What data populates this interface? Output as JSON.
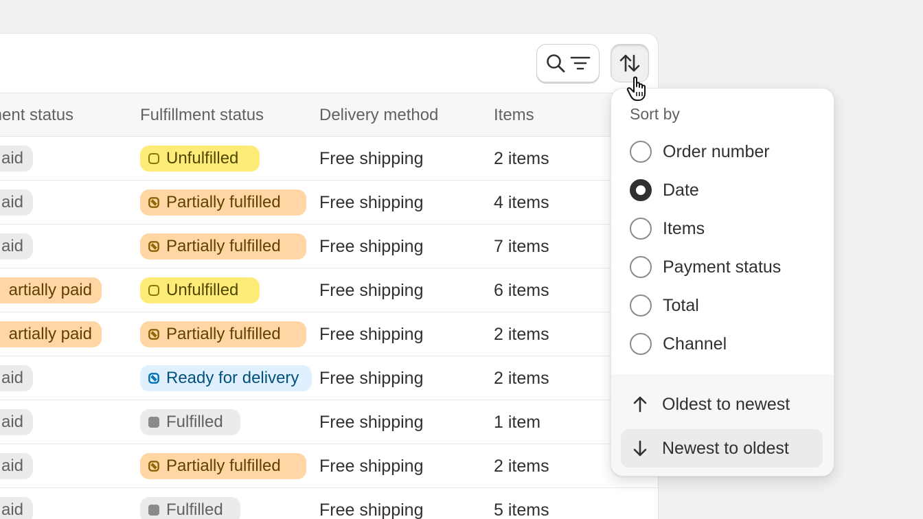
{
  "toolbar": {
    "search_filter_icon": "search-filter-icon",
    "sort_icon": "sort-arrows-icon"
  },
  "table": {
    "headers": [
      "ment status",
      "Fulfillment status",
      "Delivery method",
      "Items"
    ],
    "rows": [
      {
        "payment": "aid",
        "payment_style": "gray",
        "fulfillment": "Unfulfilled",
        "fulfillment_style": "yellow",
        "delivery": "Free shipping",
        "items": "2 items"
      },
      {
        "payment": "aid",
        "payment_style": "gray",
        "fulfillment": "Partially fulfilled",
        "fulfillment_style": "orange",
        "delivery": "Free shipping",
        "items": "4 items"
      },
      {
        "payment": "aid",
        "payment_style": "gray",
        "fulfillment": "Partially fulfilled",
        "fulfillment_style": "orange",
        "delivery": "Free shipping",
        "items": "7 items"
      },
      {
        "payment": "artially paid",
        "payment_style": "orange",
        "fulfillment": "Unfulfilled",
        "fulfillment_style": "yellow",
        "delivery": "Free shipping",
        "items": "6 items"
      },
      {
        "payment": "artially paid",
        "payment_style": "orange",
        "fulfillment": "Partially fulfilled",
        "fulfillment_style": "orange",
        "delivery": "Free shipping",
        "items": "2 items"
      },
      {
        "payment": "aid",
        "payment_style": "gray",
        "fulfillment": "Ready for delivery",
        "fulfillment_style": "blue",
        "delivery": "Free shipping",
        "items": "2 items"
      },
      {
        "payment": "aid",
        "payment_style": "gray",
        "fulfillment": "Fulfilled",
        "fulfillment_style": "gray",
        "delivery": "Free shipping",
        "items": "1 item"
      },
      {
        "payment": "aid",
        "payment_style": "gray",
        "fulfillment": "Partially fulfilled",
        "fulfillment_style": "orange",
        "delivery": "Free shipping",
        "items": "2 items"
      },
      {
        "payment": "aid",
        "payment_style": "gray",
        "fulfillment": "Fulfilled",
        "fulfillment_style": "gray",
        "delivery": "Free shipping",
        "items": "5 items"
      }
    ]
  },
  "sort_popover": {
    "title": "Sort by",
    "options": [
      {
        "label": "Order number",
        "selected": false
      },
      {
        "label": "Date",
        "selected": true
      },
      {
        "label": "Items",
        "selected": false
      },
      {
        "label": "Payment status",
        "selected": false
      },
      {
        "label": "Total",
        "selected": false
      },
      {
        "label": "Channel",
        "selected": false
      }
    ],
    "directions": [
      {
        "label": "Oldest to newest",
        "icon": "arrow-up-icon",
        "selected": false
      },
      {
        "label": "Newest to oldest",
        "icon": "arrow-down-icon",
        "selected": true
      }
    ]
  },
  "colors": {
    "yellow_badge": "#ffeb78",
    "orange_badge": "#ffd6a4",
    "blue_badge": "#e0f0ff",
    "gray_badge": "#ebebeb"
  }
}
